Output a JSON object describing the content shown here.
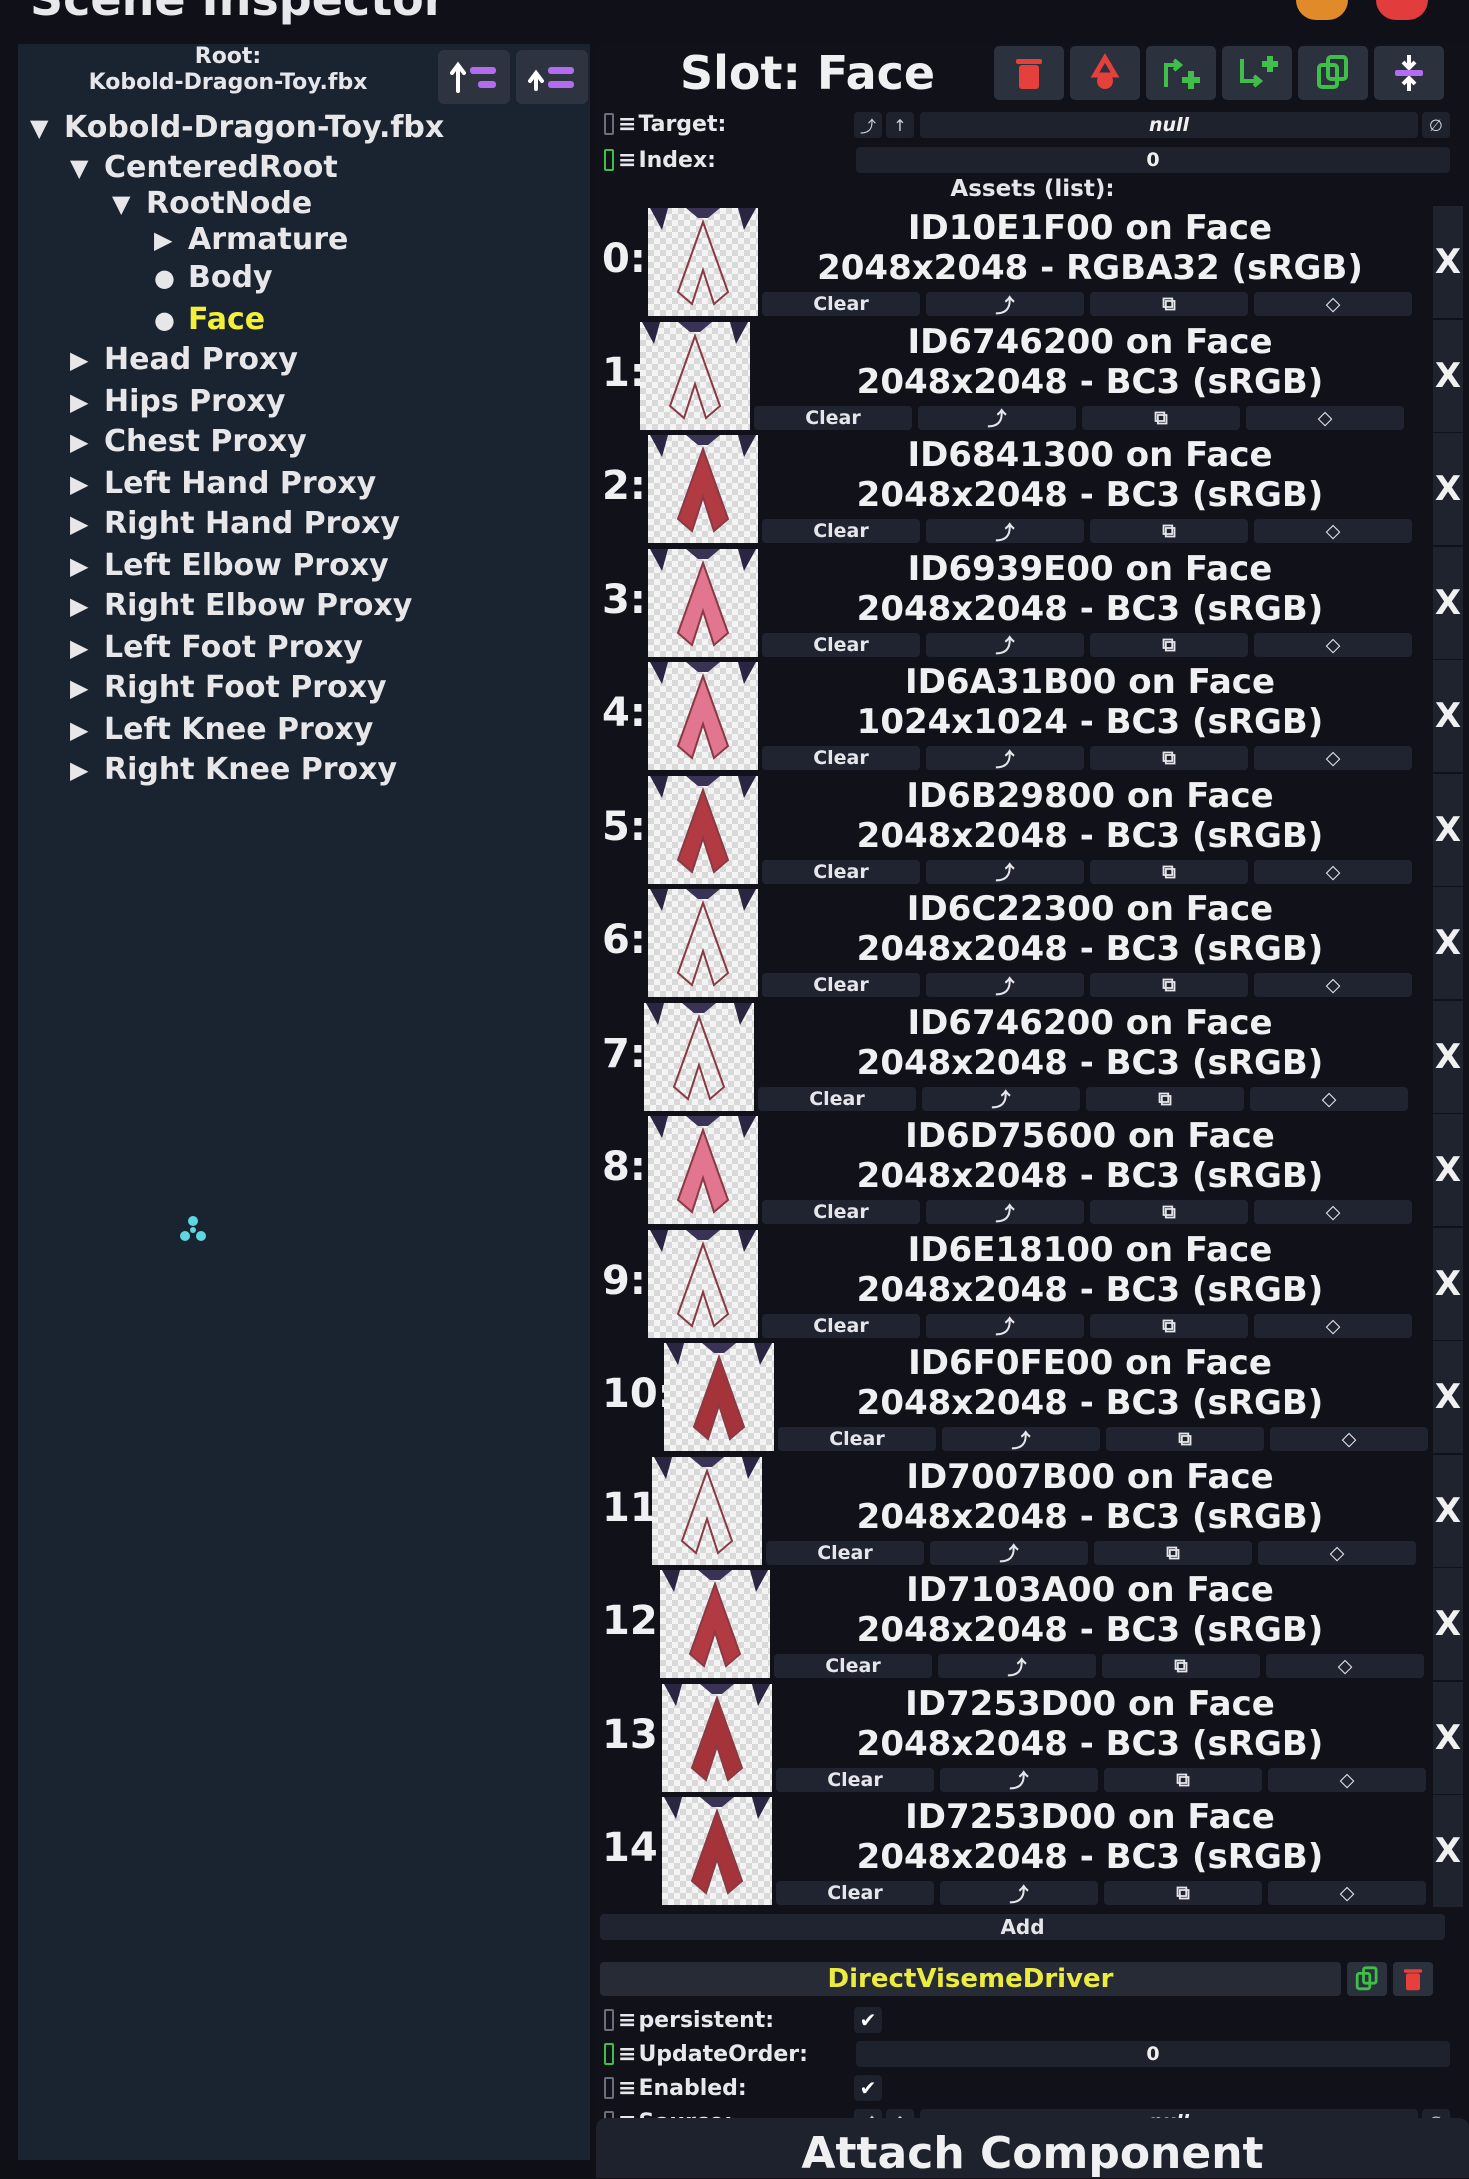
{
  "window": {
    "title": "Scene Inspector"
  },
  "left_panel": {
    "root_label": "Root:",
    "root_name": "Kobold-Dragon-Toy.fbx",
    "tree": [
      {
        "label": "Kobold-Dragon-Toy.fbx",
        "indent": 0,
        "marker": "expanded",
        "selected": false
      },
      {
        "label": "CenteredRoot",
        "indent": 1,
        "marker": "expanded",
        "selected": false
      },
      {
        "label": "RootNode",
        "indent": 2,
        "marker": "expanded",
        "selected": false
      },
      {
        "label": "Armature",
        "indent": 3,
        "marker": "collapsed",
        "selected": false
      },
      {
        "label": "Body",
        "indent": 3,
        "marker": "leaf",
        "selected": false
      },
      {
        "label": "Face",
        "indent": 3,
        "marker": "leaf",
        "selected": true
      },
      {
        "label": "Head Proxy",
        "indent": 1,
        "marker": "collapsed",
        "selected": false
      },
      {
        "label": "Hips Proxy",
        "indent": 1,
        "marker": "collapsed",
        "selected": false
      },
      {
        "label": "Chest Proxy",
        "indent": 1,
        "marker": "collapsed",
        "selected": false
      },
      {
        "label": "Left Hand Proxy",
        "indent": 1,
        "marker": "collapsed",
        "selected": false
      },
      {
        "label": "Right Hand Proxy",
        "indent": 1,
        "marker": "collapsed",
        "selected": false
      },
      {
        "label": "Left Elbow Proxy",
        "indent": 1,
        "marker": "collapsed",
        "selected": false
      },
      {
        "label": "Right Elbow Proxy",
        "indent": 1,
        "marker": "collapsed",
        "selected": false
      },
      {
        "label": "Left Foot Proxy",
        "indent": 1,
        "marker": "collapsed",
        "selected": false
      },
      {
        "label": "Right Foot Proxy",
        "indent": 1,
        "marker": "collapsed",
        "selected": false
      },
      {
        "label": "Left Knee Proxy",
        "indent": 1,
        "marker": "collapsed",
        "selected": false
      },
      {
        "label": "Right Knee Proxy",
        "indent": 1,
        "marker": "collapsed",
        "selected": false
      }
    ]
  },
  "inspector": {
    "slot_title": "Slot: Face",
    "target": {
      "label": "Target:",
      "value": "null",
      "clear_glyph": "∅"
    },
    "index": {
      "label": "Index:",
      "value": "0"
    },
    "assets_header": "Assets (list):",
    "asset_buttons": {
      "clear": "Clear",
      "jump": "⤴",
      "copy": "⧉",
      "tag": "◇",
      "remove": "X"
    },
    "assets": [
      {
        "index": "0:",
        "line1": "ID10E1F00 on Face",
        "line2": "2048x2048 - RGBA32 (sRGB)",
        "tint": "light"
      },
      {
        "index": "1:",
        "line1": "ID6746200 on Face",
        "line2": "2048x2048 - BC3 (sRGB)",
        "tint": "light"
      },
      {
        "index": "2:",
        "line1": "ID6841300 on Face",
        "line2": "2048x2048 - BC3 (sRGB)",
        "tint": "red"
      },
      {
        "index": "3:",
        "line1": "ID6939E00 on Face",
        "line2": "2048x2048 - BC3 (sRGB)",
        "tint": "pink"
      },
      {
        "index": "4:",
        "line1": "ID6A31B00 on Face",
        "line2": "1024x1024 - BC3 (sRGB)",
        "tint": "pink"
      },
      {
        "index": "5:",
        "line1": "ID6B29800 on Face",
        "line2": "2048x2048 - BC3 (sRGB)",
        "tint": "red"
      },
      {
        "index": "6:",
        "line1": "ID6C22300 on Face",
        "line2": "2048x2048 - BC3 (sRGB)",
        "tint": "outline"
      },
      {
        "index": "7:",
        "line1": "ID6746200 on Face",
        "line2": "2048x2048 - BC3 (sRGB)",
        "tint": "light"
      },
      {
        "index": "8:",
        "line1": "ID6D75600 on Face",
        "line2": "2048x2048 - BC3 (sRGB)",
        "tint": "pink"
      },
      {
        "index": "9:",
        "line1": "ID6E18100 on Face",
        "line2": "2048x2048 - BC3 (sRGB)",
        "tint": "outline"
      },
      {
        "index": "10:",
        "line1": "ID6F0FE00 on Face",
        "line2": "2048x2048 - BC3 (sRGB)",
        "tint": "dark"
      },
      {
        "index": "11:",
        "line1": "ID7007B00 on Face",
        "line2": "2048x2048 - BC3 (sRGB)",
        "tint": "outline"
      },
      {
        "index": "12:",
        "line1": "ID7103A00 on Face",
        "line2": "2048x2048 - BC3 (sRGB)",
        "tint": "red"
      },
      {
        "index": "13:",
        "line1": "ID7253D00 on Face",
        "line2": "2048x2048 - BC3 (sRGB)",
        "tint": "dark"
      },
      {
        "index": "14:",
        "line1": "ID7253D00 on Face",
        "line2": "2048x2048 - BC3 (sRGB)",
        "tint": "dark"
      }
    ],
    "add_label": "Add",
    "component": {
      "name": "DirectVisemeDriver",
      "fields": [
        {
          "label": "persistent:",
          "kind": "check",
          "value": "✔"
        },
        {
          "label": "UpdateOrder:",
          "kind": "number",
          "value": "0"
        },
        {
          "label": "Enabled:",
          "kind": "check",
          "value": "✔"
        },
        {
          "label": "Source:",
          "kind": "ref",
          "value": "null"
        }
      ]
    },
    "attach_label": "Attach Component"
  },
  "colors": {
    "selected_text": "#f2f03a",
    "component_name": "#ecec40",
    "delete_red": "#e6403c",
    "create_green": "#3fbf4a",
    "parent_purple": "#b36cf0",
    "spinner_cyan": "#5fd7e0"
  }
}
